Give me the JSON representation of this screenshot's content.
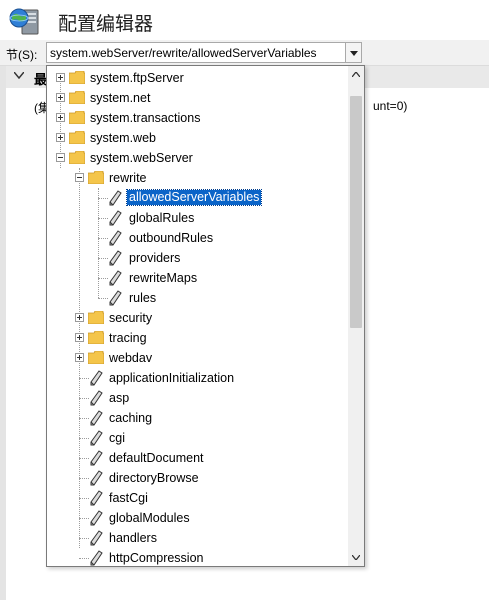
{
  "app": {
    "title": "配置编辑器",
    "icon": "server-globe-icon"
  },
  "section": {
    "label": "节(S):",
    "value": "system.webServer/rewrite/allowedServerVariables"
  },
  "behind": {
    "group_title": "最",
    "group_sub": "(集",
    "count_text": "unt=0)"
  },
  "tree": {
    "ftpServer": "system.ftpServer",
    "net": "system.net",
    "transactions": "system.transactions",
    "web": "system.web",
    "webServer": "system.webServer",
    "rewrite": "rewrite",
    "allowedServerVariables": "allowedServerVariables",
    "globalRules": "globalRules",
    "outboundRules": "outboundRules",
    "providers": "providers",
    "rewriteMaps": "rewriteMaps",
    "rules": "rules",
    "security": "security",
    "tracing": "tracing",
    "webdav": "webdav",
    "applicationInitialization": "applicationInitialization",
    "asp": "asp",
    "caching": "caching",
    "cgi": "cgi",
    "defaultDocument": "defaultDocument",
    "directoryBrowse": "directoryBrowse",
    "fastCgi": "fastCgi",
    "globalModules": "globalModules",
    "handlers": "handlers",
    "httpCompression": "httpCompression"
  },
  "colors": {
    "selection": "#0a64c8",
    "folder": "#f4c54a"
  }
}
